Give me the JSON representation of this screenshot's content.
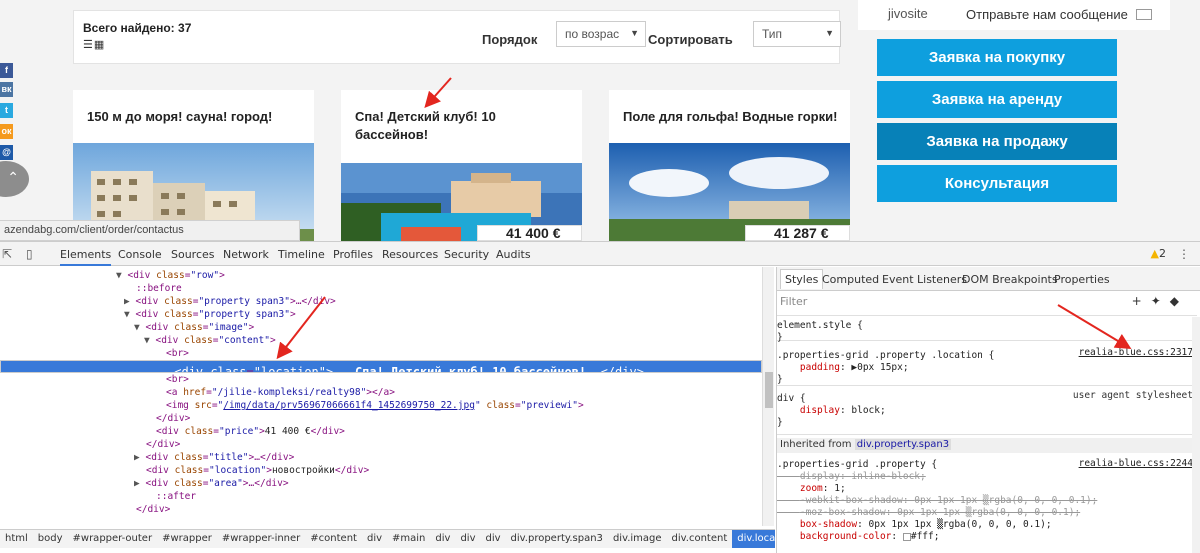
{
  "page": {
    "found_label": "Всего найдено: 37",
    "order_label": "Порядок",
    "order_select": "по возрас",
    "sort_label": "Сортировать",
    "sort_select": "Тип",
    "cards": [
      {
        "title": "150 м до моря! сауна! город!",
        "price": ""
      },
      {
        "title": "Спа! Детский клуб! 10 бассейнов!",
        "price": "41 400 €"
      },
      {
        "title": "Поле для гольфа! Водные горки!",
        "price": "41 287 €"
      }
    ],
    "status_url": "azendabg.com/client/order/contactus",
    "social": [
      "f",
      "вк",
      "t",
      "ок",
      "@"
    ],
    "jivo": {
      "logo": "jivosite",
      "message": "Отправьте нам сообщение"
    },
    "side_buttons": [
      "Заявка на покупку",
      "Заявка на аренду",
      "Заявка на продажу",
      "Консультация"
    ]
  },
  "devtools": {
    "tabs": [
      "Elements",
      "Console",
      "Sources",
      "Network",
      "Timeline",
      "Profiles",
      "Resources",
      "Security",
      "Audits"
    ],
    "active_tab": "Elements",
    "warnings": "2",
    "dom": {
      "n0": {
        "tag": "div",
        "attr": "class",
        "val": "row"
      },
      "n1": "::before",
      "n2": {
        "tag": "div",
        "attr": "class",
        "val": "property span3",
        "ellipsis": "…</div>"
      },
      "n3": {
        "tag": "div",
        "attr": "class",
        "val": "property span3"
      },
      "n4": {
        "tag": "div",
        "attr": "class",
        "val": "image"
      },
      "n5": {
        "tag": "div",
        "attr": "class",
        "val": "content"
      },
      "n6": "<br>",
      "n7": {
        "tag": "div",
        "attr": "class",
        "val": "location",
        "text": "Спа! Детский клуб! 10 бассейнов!",
        "close": "</div>"
      },
      "n8": "<br>",
      "n9": {
        "tag": "a",
        "attr": "href",
        "val": "/jilie-kompleksi/realty98",
        "close": "</a>"
      },
      "n10": {
        "tag": "img",
        "attr": "src",
        "val": "/img/data/prv56967066661f4_1452699750_22.jpg",
        "attr2": "class",
        "val2": "previewi"
      },
      "n11": "</div>",
      "n12": {
        "tag": "div",
        "attr": "class",
        "val": "price",
        "text": "41 400 €",
        "close": "</div>"
      },
      "n13": "</div>",
      "n14": {
        "tag": "div",
        "attr": "class",
        "val": "title",
        "ellipsis": "…</div>"
      },
      "n15": {
        "tag": "div",
        "attr": "class",
        "val": "location",
        "text": "новостройки",
        "close": "</div>"
      },
      "n16": {
        "tag": "div",
        "attr": "class",
        "val": "area",
        "ellipsis": "…</div>"
      },
      "n17": "::after",
      "n18": "</div>"
    },
    "breadcrumbs": [
      "html",
      "body",
      "#wrapper-outer",
      "#wrapper",
      "#wrapper-inner",
      "#content",
      "div",
      "#main",
      "div",
      "div",
      "div",
      "div.property.span3",
      "div.image",
      "div.content",
      "div.location"
    ],
    "styles_tabs": [
      "Styles",
      "Computed",
      "Event Listeners",
      "DOM Breakpoints",
      "Properties"
    ],
    "filter_placeholder": "Filter",
    "rules": {
      "element_style": "element.style {",
      "r1_selector": ".properties-grid .property .location {",
      "r1_source": "realia-blue.css:2317",
      "r1_prop": "padding",
      "r1_val": "▶0px 15px;",
      "r2_selector": "div {",
      "r2_source": "user agent stylesheet",
      "r2_prop": "display",
      "r2_val": "block;",
      "inherited_label": "Inherited from",
      "inherited_from": "div.property.span3",
      "r3_selector": ".properties-grid .property {",
      "r3_source": "realia-blue.css:2244",
      "r3_lines": [
        {
          "prop": "display",
          "val": "inline-block;",
          "strike": true
        },
        {
          "prop": "zoom",
          "val": "1;",
          "strike": false
        },
        {
          "prop": "-webkit-box-shadow",
          "val": "0px 1px 1px ▒rgba(0, 0, 0, 0.1);",
          "strike": true
        },
        {
          "prop": "-moz-box-shadow",
          "val": "0px 1px 1px ▒rgba(0, 0, 0, 0.1);",
          "strike": true
        },
        {
          "prop": "box-shadow",
          "val": "0px 1px 1px ▒rgba(0, 0, 0, 0.1);",
          "strike": false
        },
        {
          "prop": "background-color",
          "val": "#fff;",
          "strike": false
        }
      ]
    }
  },
  "colors": {
    "accent": "#0e9fde",
    "devtools_selection": "#3879d9",
    "annotation_arrow": "#e3261f"
  }
}
